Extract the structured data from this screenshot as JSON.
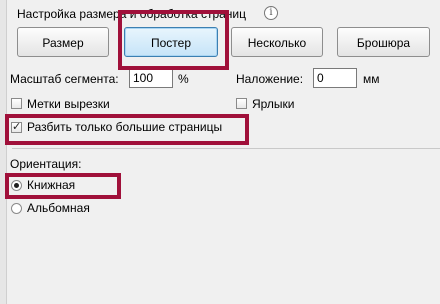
{
  "panel": {
    "section_title": "Настройка размера и обработка страниц",
    "info_glyph": "i"
  },
  "mode_buttons": [
    {
      "label": "Размер",
      "selected": false
    },
    {
      "label": "Постер",
      "selected": true
    },
    {
      "label": "Несколько",
      "selected": false
    },
    {
      "label": "Брошюра",
      "selected": false
    }
  ],
  "tile_scale": {
    "label": "Масштаб сегмента:",
    "value": "100",
    "unit": "%"
  },
  "overlap": {
    "label": "Наложение:",
    "value": "0",
    "unit": "мм"
  },
  "checkboxes": {
    "cut_marks": {
      "label": "Метки вырезки",
      "checked": false
    },
    "labels": {
      "label": "Ярлыки",
      "checked": false
    },
    "split_large_only": {
      "label": "Разбить только большие страницы",
      "checked": true
    }
  },
  "orientation": {
    "title": "Ориентация:",
    "options": [
      {
        "label": "Книжная",
        "checked": true
      },
      {
        "label": "Альбомная",
        "checked": false
      }
    ]
  },
  "colors": {
    "highlight": "#a0103a",
    "selected_button": "#c6e4f8"
  }
}
